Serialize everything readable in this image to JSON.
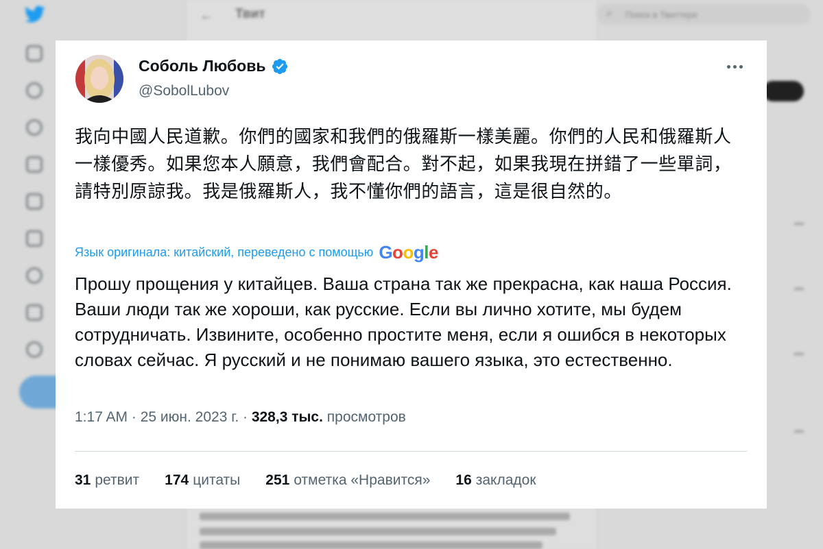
{
  "background": {
    "header_title": "Твит",
    "search_placeholder": "Поиск в Твиттере"
  },
  "tweet": {
    "author_name": "Соболь Любовь",
    "author_handle": "@SobolLubov",
    "original_text": "我向中國人民道歉。你們的國家和我們的俄羅斯一樣美麗。你們的人民和俄羅斯人一樣優秀。如果您本人願意，我們會配合。對不起，如果我現在拼錯了一些單詞，請特別原諒我。我是俄羅斯人，我不懂你們的語言，這是很自然的。",
    "translation_note": "Язык оригинала: китайский, переведено с помощью",
    "translation_provider": "Google",
    "translated_text": "Прошу прощения у китайцев. Ваша страна так же прекрасна, как наша Россия. Ваши люди так же хороши, как русские. Если вы лично хотите, мы будем сотрудничать. Извините, особенно простите меня, если я ошибся в некоторых словах сейчас. Я русский и не понимаю вашего языка, это естественно.",
    "time": "1:17 AM",
    "date": "25 июн. 2023 г.",
    "views_count": "328,3 тыс.",
    "views_label": "просмотров",
    "stats": [
      {
        "count": "31",
        "label": "ретвит"
      },
      {
        "count": "174",
        "label": "цитаты"
      },
      {
        "count": "251",
        "label": "отметка «Нравится»"
      },
      {
        "count": "16",
        "label": "закладок"
      }
    ]
  },
  "colors": {
    "accent": "#1d9bf0",
    "secondary_text": "#536471",
    "primary_text": "#0f1419",
    "verified_badge": "#1d9bf0"
  },
  "icons": [
    "twitter-bird-icon",
    "verified-badge-icon",
    "more-icon",
    "avatar"
  ]
}
